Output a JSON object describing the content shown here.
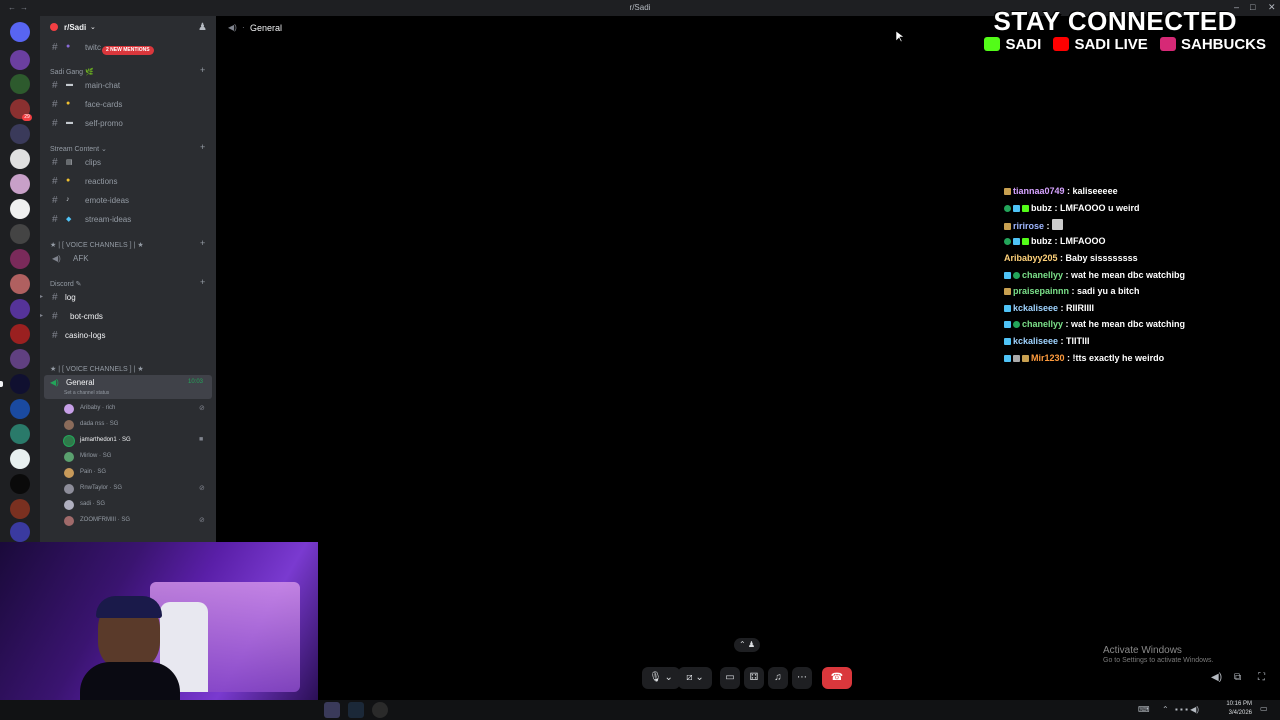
{
  "window": {
    "title": "r/Sadi"
  },
  "server": {
    "name": "r/Sadi"
  },
  "channels": {
    "top_channel": "twitc",
    "mentions_badge": "2 NEW MENTIONS",
    "categories": [
      {
        "name": "Sadi Gang",
        "items": [
          "main-chat",
          "face-cards",
          "self-promo"
        ]
      },
      {
        "name": "Stream Content",
        "items": [
          "clips",
          "reactions",
          "emote-ideas",
          "stream-ideas"
        ]
      },
      {
        "name": "★ | [ VOICE CHANNELS ] | ★",
        "items": [
          "AFK"
        ]
      },
      {
        "name": "Discord",
        "items": [
          "log",
          "bot-cmds",
          "casino-logs"
        ]
      },
      {
        "name": "★ | [ VOICE CHANNELS ] | ★",
        "items": []
      }
    ],
    "voice_channel": {
      "name": "General",
      "timer": "10:03",
      "status": "Set a channel status"
    },
    "voice_users": [
      {
        "name": "Aribaby",
        "tag": "rich",
        "color": "#c7a0e8"
      },
      {
        "name": "dada nss",
        "tag": "SG",
        "color": "#8a6b5a"
      },
      {
        "name": "jamarthedon1",
        "tag": "SG",
        "color": "#2f7a4a"
      },
      {
        "name": "Mirlow",
        "tag": "SG",
        "color": "#5aa06e"
      },
      {
        "name": "Pain",
        "tag": "SG",
        "color": "#c89a5a"
      },
      {
        "name": "RnwTaylor",
        "tag": "SG",
        "color": "#8d8d9a"
      },
      {
        "name": "sadi",
        "tag": "SG",
        "color": "#b0b0c0"
      },
      {
        "name": "ZOOMFRMIII",
        "tag": "SG",
        "color": "#a06a6a"
      }
    ]
  },
  "header": {
    "channel_name": "General"
  },
  "overlay": {
    "stay_connected": "STAY CONNECTED",
    "socials": [
      {
        "name": "SADI",
        "icon": "kick-icon",
        "color": "#53fc18"
      },
      {
        "name": "SADI LIVE",
        "icon": "youtube-icon",
        "color": "#ff0000"
      },
      {
        "name": "SAHBUCKS",
        "icon": "instagram-icon",
        "color": "#d62976"
      }
    ]
  },
  "chat": [
    {
      "user": "tiannaa0749",
      "msg": "kaliseeeee",
      "color": "#d6a3ff"
    },
    {
      "user": "bubz",
      "msg": "LMFAOOO u weird",
      "color": "#ffffff"
    },
    {
      "user": "ririrose",
      "msg": "",
      "color": "#9fb7ff"
    },
    {
      "user": "bubz",
      "msg": "LMFAOOO",
      "color": "#ffffff"
    },
    {
      "user": "Aribabyy205",
      "msg": "Baby sissssssss",
      "color": "#ffd27a"
    },
    {
      "user": "chanellyy",
      "msg": "wat he mean dbc watchibg",
      "color": "#7be08a"
    },
    {
      "user": "praisepainnn",
      "msg": "sadi yu a bitch",
      "color": "#7be08a"
    },
    {
      "user": "kckaliseee",
      "msg": "RIIRIIII",
      "color": "#9fd3ff"
    },
    {
      "user": "chanellyy",
      "msg": "wat he mean dbc watching",
      "color": "#7be08a"
    },
    {
      "user": "kckaliseee",
      "msg": "TIITIII",
      "color": "#9fd3ff"
    },
    {
      "user": "Mir1230",
      "msg": "!tts exactly he weirdo",
      "color": "#ff9b3d"
    }
  ],
  "activate_windows": {
    "title": "Activate Windows",
    "subtitle": "Go to Settings to activate Windows."
  },
  "taskbar": {
    "time": "10:16 PM",
    "date": "3/4/2026"
  }
}
